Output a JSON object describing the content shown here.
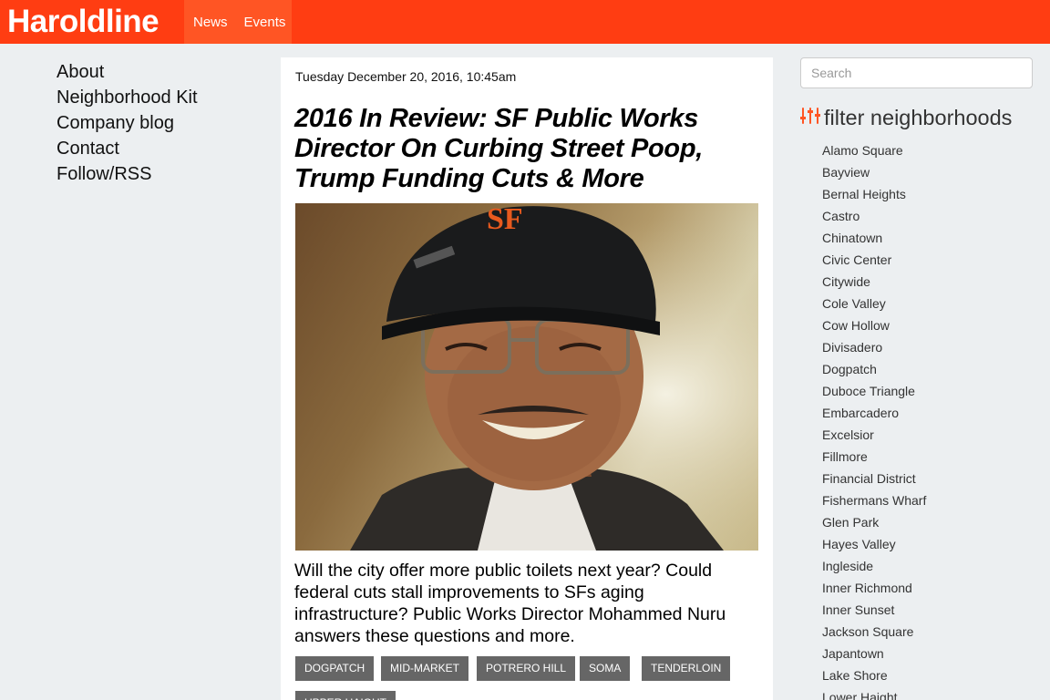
{
  "header": {
    "logo": "Haroldline",
    "nav": [
      "News",
      "Events"
    ],
    "brand_color": "#ff3d12"
  },
  "left_nav": [
    "About",
    "Neighborhood Kit",
    "Company blog",
    "Contact",
    "Follow/RSS"
  ],
  "article": {
    "date": "Tuesday December 20, 2016, 10:45am",
    "title": "2016 In Review: SF Public Works Director On Curbing Street Poop, Trump Funding Cuts & More",
    "image_alt": "smiling man in a black cap and glasses",
    "summary": "Will the city offer more public toilets next year? Could federal cuts stall improvements to SFs aging infrastructure? Public Works Director Mohammed Nuru answers these questions and more.",
    "tags": [
      "DOGPATCH",
      "MID-MARKET",
      "POTRERO HILL",
      "SOMA",
      "TENDERLOIN",
      "UPPER HAIGHT"
    ]
  },
  "sidebar": {
    "search_placeholder": "Search",
    "filter_title": "filter neighborhoods",
    "filter_icon": "sliders-icon",
    "neighborhoods": [
      "Alamo Square",
      "Bayview",
      "Bernal Heights",
      "Castro",
      "Chinatown",
      "Civic Center",
      "Citywide",
      "Cole Valley",
      "Cow Hollow",
      "Divisadero",
      "Dogpatch",
      "Duboce Triangle",
      "Embarcadero",
      "Excelsior",
      "Fillmore",
      "Financial District",
      "Fishermans Wharf",
      "Glen Park",
      "Hayes Valley",
      "Ingleside",
      "Inner Richmond",
      "Inner Sunset",
      "Jackson Square",
      "Japantown",
      "Lake Shore",
      "Lower Haight"
    ]
  }
}
